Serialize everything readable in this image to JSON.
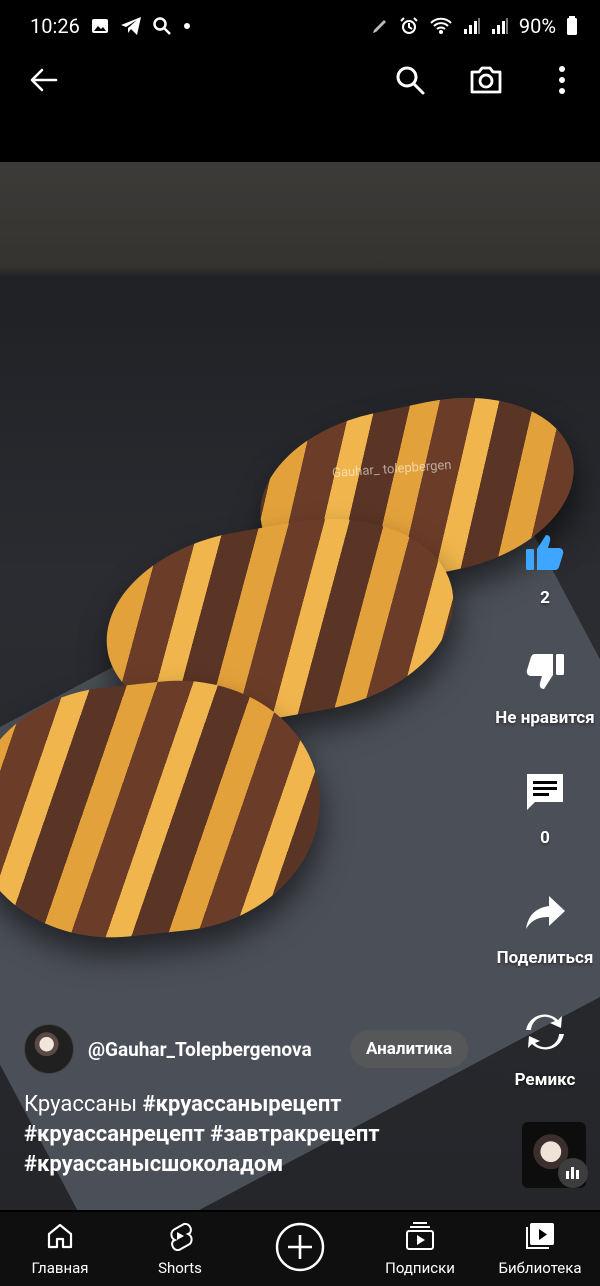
{
  "status_bar": {
    "time": "10:26",
    "battery": "90%"
  },
  "top_bar": {
    "back_icon": "arrow-left-icon",
    "search_icon": "search-icon",
    "camera_icon": "camera-icon",
    "more_icon": "more-vertical-icon"
  },
  "video": {
    "watermark": "Gauhar_ tolepbergen"
  },
  "actions": {
    "like_count": "2",
    "dislike_label": "Не нравится",
    "comment_count": "0",
    "share_label": "Поделиться",
    "remix_label": "Ремикс"
  },
  "channel": {
    "name": "@Gauhar_Tolepbergenova",
    "analytics_label": "Аналитика"
  },
  "caption": {
    "text": "Круассаны",
    "tags": [
      "#круассанырецепт",
      "#круассанрецепт",
      "#завтракрецепт",
      "#круассанысшоколадом"
    ]
  },
  "bottom_nav": {
    "items": [
      {
        "label": "Главная",
        "icon": "home-icon"
      },
      {
        "label": "Shorts",
        "icon": "shorts-icon"
      },
      {
        "label": "",
        "icon": "create-plus-icon"
      },
      {
        "label": "Подписки",
        "icon": "subscriptions-icon"
      },
      {
        "label": "Библиотека",
        "icon": "library-icon"
      }
    ]
  },
  "colors": {
    "like_active": "#3ea6ff",
    "background": "#000000",
    "nav_background": "#0f0f0f"
  }
}
